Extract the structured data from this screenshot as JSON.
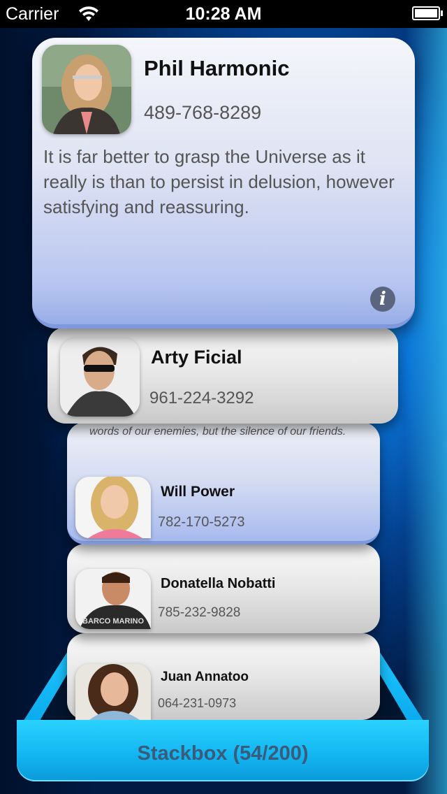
{
  "status_bar": {
    "carrier": "Carrier",
    "time": "10:28 AM"
  },
  "top_card": {
    "name": "Phil Harmonic",
    "phone": "489-768-8289",
    "quote": "It is far better to grasp the Universe as it really is than to persist in delusion, however satisfying and reassuring.",
    "info_icon": "i"
  },
  "cards": [
    {
      "name": "Arty Ficial",
      "phone": "961-224-3292"
    },
    {
      "name": "Will Power",
      "phone": "782-170-5273",
      "snippet": "words of our enemies, but the silence of our friends."
    },
    {
      "name": "Donatella Nobatti",
      "phone": "785-232-9828"
    },
    {
      "name": "Juan Annatoo",
      "phone": "064-231-0973"
    }
  ],
  "stackbox": {
    "label": "Stackbox (54/200)"
  },
  "colors": {
    "box_blue": "#12b4f0",
    "box_label": "#3a5b7a",
    "top_card_tint": "#b9c6f0"
  }
}
